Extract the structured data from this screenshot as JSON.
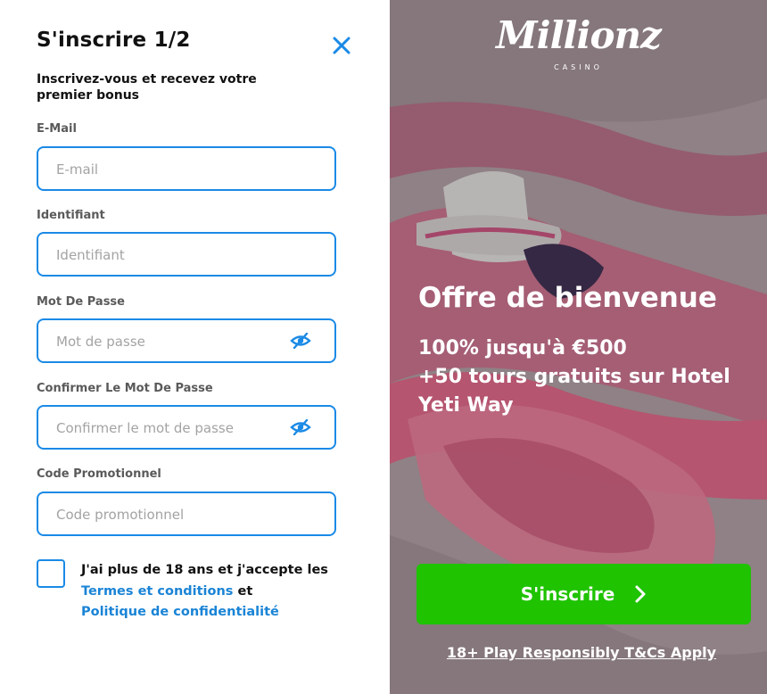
{
  "form": {
    "title": "S'inscrire 1/2",
    "subtitle": "Inscrivez-vous et recevez votre premier bonus",
    "fields": [
      {
        "label": "E-Mail",
        "placeholder": "E-mail",
        "value": ""
      },
      {
        "label": "Identifiant",
        "placeholder": "Identifiant",
        "value": ""
      },
      {
        "label": "Mot De Passe",
        "placeholder": "Mot de passe",
        "value": ""
      },
      {
        "label": "Confirmer Le Mot De Passe",
        "placeholder": "Confirmer le mot de passe",
        "value": ""
      },
      {
        "label": "Code Promotionnel",
        "placeholder": "Code promotionnel",
        "value": ""
      }
    ],
    "consent": {
      "text_before": "J'ai plus de 18 ans et j'accepte les",
      "terms_link": "Termes et conditions",
      "joiner": "et",
      "privacy_link": "Politique de confidentialité",
      "checked": false
    },
    "close_icon": "close-icon",
    "eye_icon": "eye-slash-icon"
  },
  "promo": {
    "logo": "Millionz",
    "logo_sub": "CASINO",
    "offer_title": "Offre de bienvenue",
    "offer_line1": "100% jusqu'à €500",
    "offer_line2": "+50 tours gratuits sur Hotel Yeti Way",
    "cta_label": "S'inscrire",
    "footer_link": "18+ Play Responsibly T&Cs Apply"
  },
  "colors": {
    "accent_blue": "#1a8ae6",
    "cta_green": "#1fc300",
    "promo_bg": "#a9989d"
  }
}
